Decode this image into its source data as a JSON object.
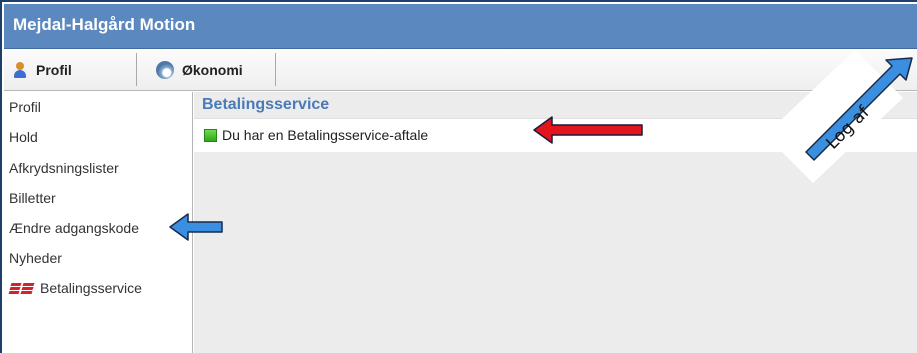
{
  "app": {
    "title": "Mejdal-Halgård Motion"
  },
  "toolbar": {
    "items": [
      {
        "label": "Profil",
        "icon": "user-icon"
      },
      {
        "label": "Økonomi",
        "icon": "economy-icon"
      }
    ]
  },
  "sidebar": {
    "items": [
      {
        "label": "Profil"
      },
      {
        "label": "Hold"
      },
      {
        "label": "Afkrydsningslister"
      },
      {
        "label": "Billetter"
      },
      {
        "label": "Ændre adgangskode"
      },
      {
        "label": "Nyheder"
      },
      {
        "label": "Betalingsservice",
        "icon": "betalingsservice-logo-icon"
      }
    ]
  },
  "main": {
    "title": "Betalingsservice",
    "status": {
      "text": "Du har en Betalingsservice-aftale",
      "icon": "green-status-icon",
      "color": "#3cbf2a"
    }
  },
  "annotations": {
    "logout_label": "Log af",
    "colors": {
      "blue_arrow": "#3a8fe0",
      "red_arrow": "#e2141c"
    }
  }
}
